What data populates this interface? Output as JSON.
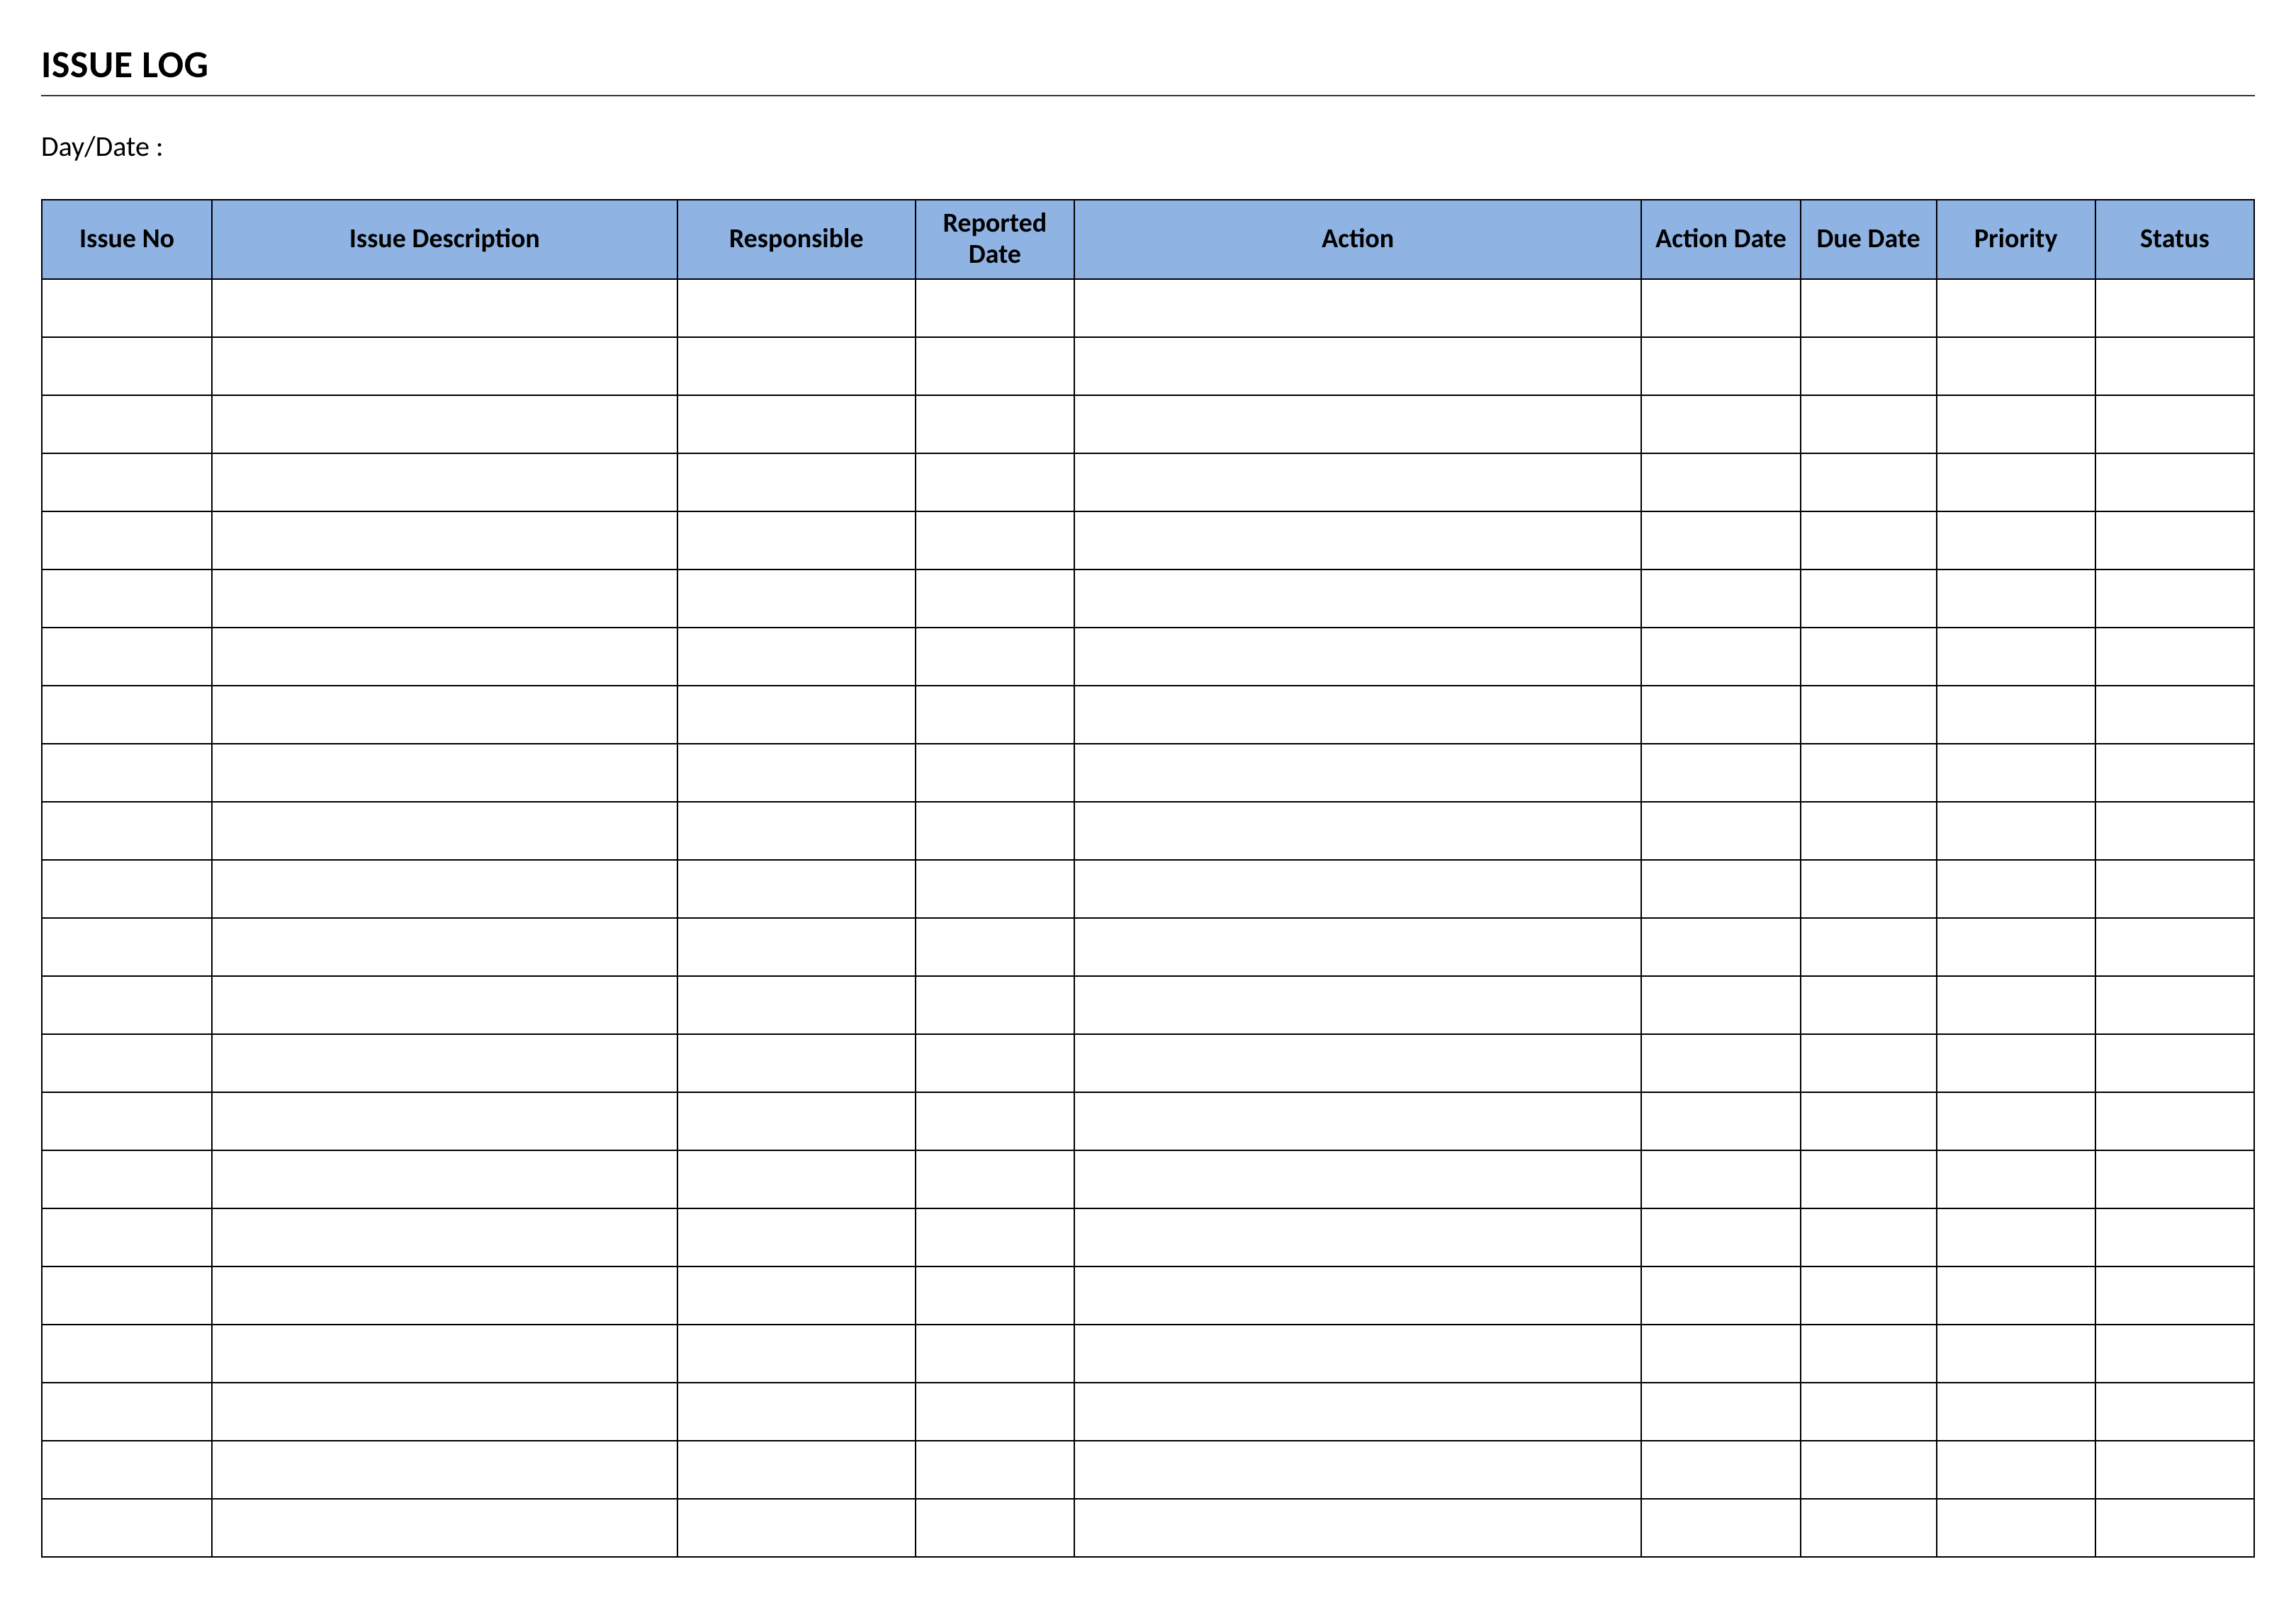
{
  "title": "ISSUE LOG",
  "date_label": "Day/Date :",
  "columns": [
    {
      "label": "Issue No"
    },
    {
      "label": "Issue Description"
    },
    {
      "label": "Responsible"
    },
    {
      "label": "Reported Date"
    },
    {
      "label": "Action"
    },
    {
      "label": "Action Date"
    },
    {
      "label": "Due Date"
    },
    {
      "label": "Priority"
    },
    {
      "label": "Status"
    }
  ],
  "rows": [
    [
      "",
      "",
      "",
      "",
      "",
      "",
      "",
      "",
      ""
    ],
    [
      "",
      "",
      "",
      "",
      "",
      "",
      "",
      "",
      ""
    ],
    [
      "",
      "",
      "",
      "",
      "",
      "",
      "",
      "",
      ""
    ],
    [
      "",
      "",
      "",
      "",
      "",
      "",
      "",
      "",
      ""
    ],
    [
      "",
      "",
      "",
      "",
      "",
      "",
      "",
      "",
      ""
    ],
    [
      "",
      "",
      "",
      "",
      "",
      "",
      "",
      "",
      ""
    ],
    [
      "",
      "",
      "",
      "",
      "",
      "",
      "",
      "",
      ""
    ],
    [
      "",
      "",
      "",
      "",
      "",
      "",
      "",
      "",
      ""
    ],
    [
      "",
      "",
      "",
      "",
      "",
      "",
      "",
      "",
      ""
    ],
    [
      "",
      "",
      "",
      "",
      "",
      "",
      "",
      "",
      ""
    ],
    [
      "",
      "",
      "",
      "",
      "",
      "",
      "",
      "",
      ""
    ],
    [
      "",
      "",
      "",
      "",
      "",
      "",
      "",
      "",
      ""
    ],
    [
      "",
      "",
      "",
      "",
      "",
      "",
      "",
      "",
      ""
    ],
    [
      "",
      "",
      "",
      "",
      "",
      "",
      "",
      "",
      ""
    ],
    [
      "",
      "",
      "",
      "",
      "",
      "",
      "",
      "",
      ""
    ],
    [
      "",
      "",
      "",
      "",
      "",
      "",
      "",
      "",
      ""
    ],
    [
      "",
      "",
      "",
      "",
      "",
      "",
      "",
      "",
      ""
    ],
    [
      "",
      "",
      "",
      "",
      "",
      "",
      "",
      "",
      ""
    ],
    [
      "",
      "",
      "",
      "",
      "",
      "",
      "",
      "",
      ""
    ],
    [
      "",
      "",
      "",
      "",
      "",
      "",
      "",
      "",
      ""
    ],
    [
      "",
      "",
      "",
      "",
      "",
      "",
      "",
      "",
      ""
    ],
    [
      "",
      "",
      "",
      "",
      "",
      "",
      "",
      "",
      ""
    ]
  ]
}
